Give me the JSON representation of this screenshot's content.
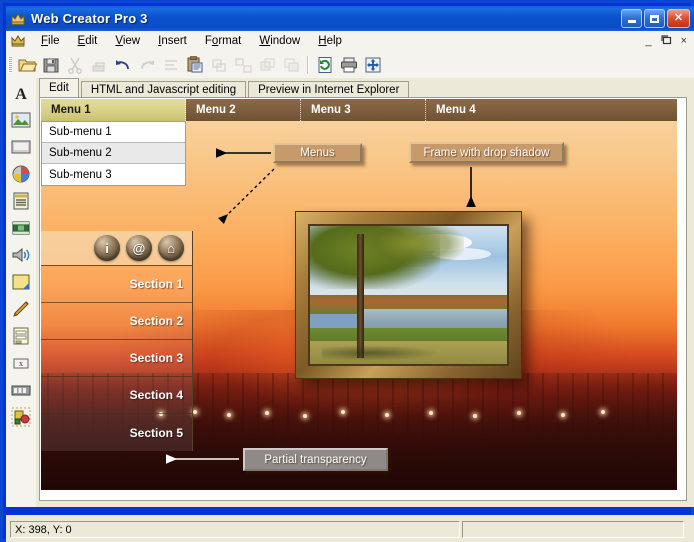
{
  "window": {
    "title": "Web Creator Pro 3",
    "app_icon": "crown-icon",
    "controls": {
      "minimize": "minimize-icon",
      "maximize": "maximize-icon",
      "close": "close-icon"
    },
    "mdi_controls": {
      "minimize": "_",
      "restore": "❐",
      "close": "×"
    }
  },
  "menubar": {
    "app_icon": "crown-icon",
    "items": [
      {
        "pre": "",
        "key": "F",
        "post": "ile"
      },
      {
        "pre": "",
        "key": "E",
        "post": "dit"
      },
      {
        "pre": "",
        "key": "V",
        "post": "iew"
      },
      {
        "pre": "",
        "key": "I",
        "post": "nsert"
      },
      {
        "pre": "F",
        "key": "o",
        "post": "rmat"
      },
      {
        "pre": "",
        "key": "W",
        "post": "indow"
      },
      {
        "pre": "",
        "key": "H",
        "post": "elp"
      }
    ]
  },
  "toolbar": {
    "buttons": [
      {
        "name": "open-icon",
        "glyph": "📂",
        "enabled": true
      },
      {
        "name": "save-icon",
        "glyph": "💾",
        "enabled": true
      },
      {
        "name": "cut-icon",
        "glyph": "✂",
        "enabled": false
      },
      {
        "name": "copy-icon",
        "glyph": "⧉",
        "enabled": false
      },
      {
        "name": "undo-icon",
        "glyph": "↶",
        "enabled": true
      },
      {
        "name": "redo-icon",
        "glyph": "↷",
        "enabled": false
      },
      {
        "name": "align-icon",
        "glyph": "☰",
        "enabled": false
      },
      {
        "name": "paste-icon",
        "glyph": "📋",
        "enabled": true
      },
      {
        "name": "group-icon",
        "glyph": "◰",
        "enabled": false
      },
      {
        "name": "ungroup-icon",
        "glyph": "◱",
        "enabled": false
      },
      {
        "name": "layer-up-icon",
        "glyph": "◧",
        "enabled": false
      },
      {
        "name": "layer-down-icon",
        "glyph": "◨",
        "enabled": false
      },
      {
        "name": "publish-icon",
        "glyph": "↻",
        "enabled": true
      },
      {
        "name": "print-icon",
        "glyph": "🖨",
        "enabled": true
      },
      {
        "name": "site-map-icon",
        "glyph": "✣",
        "enabled": true
      }
    ]
  },
  "vertical_toolbar": {
    "tools": [
      {
        "name": "text-tool-icon",
        "glyph": "A"
      },
      {
        "name": "image-tool-icon",
        "glyph": "🏞"
      },
      {
        "name": "button-tool-icon",
        "glyph": "▭"
      },
      {
        "name": "gallery-tool-icon",
        "glyph": "◕"
      },
      {
        "name": "menu-tool-icon",
        "glyph": "☰"
      },
      {
        "name": "flash-tool-icon",
        "glyph": "🎞"
      },
      {
        "name": "sound-tool-icon",
        "glyph": "🔈"
      },
      {
        "name": "shape-tool-icon",
        "glyph": "◥"
      },
      {
        "name": "draw-tool-icon",
        "glyph": "✎"
      },
      {
        "name": "form-tool-icon",
        "glyph": "🗒"
      },
      {
        "name": "script-tool-icon",
        "glyph": "x"
      },
      {
        "name": "counter-tool-icon",
        "glyph": "000"
      },
      {
        "name": "effects-tool-icon",
        "glyph": "❖"
      }
    ]
  },
  "tabs": [
    {
      "label": "Edit",
      "active": true
    },
    {
      "label": "HTML and Javascript editing",
      "active": false
    },
    {
      "label": "Preview in Internet Explorer",
      "active": false
    }
  ],
  "page": {
    "menu": [
      {
        "label": "Menu 1",
        "selected": true
      },
      {
        "label": "Menu 2",
        "selected": false
      },
      {
        "label": "Menu 3",
        "selected": false
      },
      {
        "label": "Menu 4",
        "selected": false
      }
    ],
    "submenu": [
      {
        "label": "Sub-menu 1"
      },
      {
        "label": "Sub-menu 2"
      },
      {
        "label": "Sub-menu 3"
      }
    ],
    "side_icons": [
      {
        "name": "info-icon",
        "glyph": "i"
      },
      {
        "name": "email-icon",
        "glyph": "@"
      },
      {
        "name": "home-icon",
        "glyph": "⌂"
      }
    ],
    "sections": [
      {
        "label": "Section 1"
      },
      {
        "label": "Section 2"
      },
      {
        "label": "Section 3"
      },
      {
        "label": "Section 4"
      },
      {
        "label": "Section 5"
      }
    ],
    "callouts": {
      "menus": "Menus",
      "frame": "Frame with drop shadow",
      "transparency": "Partial transparency"
    },
    "photo_alt": "autumn-park-lake-photo"
  },
  "statusbar": {
    "coordinates": "X: 398, Y: 0",
    "secondary": ""
  },
  "colors": {
    "titlebar": "#0a52ce",
    "menu_brown": "#7d5d3c",
    "menu_selected": "#d6cf86",
    "callout_tan": "#c79a6b",
    "callout_gray": "#8f8a88",
    "chrome": "#ece9d8"
  }
}
